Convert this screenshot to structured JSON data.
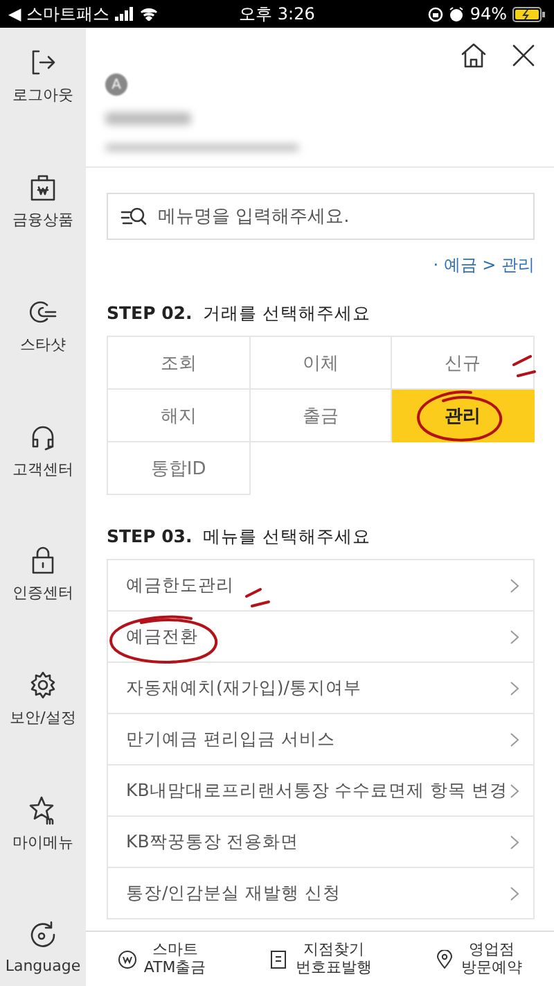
{
  "status_bar": {
    "back_app": "◀ 스마트패스",
    "time": "오후 3:26",
    "battery": "94%"
  },
  "sidebar": {
    "items": [
      {
        "label": "로그아웃"
      },
      {
        "label": "금융상품"
      },
      {
        "label": "스타샷"
      },
      {
        "label": "고객센터"
      },
      {
        "label": "인증센터"
      },
      {
        "label": "보안/설정"
      },
      {
        "label": "마이메뉴"
      },
      {
        "label": "Language"
      }
    ]
  },
  "header": {
    "avatar": "A"
  },
  "search": {
    "placeholder": "메뉴명을 입력해주세요."
  },
  "breadcrumb": "· 예금 > 관리",
  "step2": {
    "title": "STEP 02.",
    "subtitle": "거래를 선택해주세요",
    "options": [
      {
        "label": "조회",
        "selected": false
      },
      {
        "label": "이체",
        "selected": false
      },
      {
        "label": "신규",
        "selected": false
      },
      {
        "label": "해지",
        "selected": false
      },
      {
        "label": "출금",
        "selected": false
      },
      {
        "label": "관리",
        "selected": true
      },
      {
        "label": "통합ID",
        "selected": false
      }
    ]
  },
  "step3": {
    "title": "STEP 03.",
    "subtitle": "메뉴를 선택해주세요",
    "items": [
      {
        "label": "예금한도관리"
      },
      {
        "label": "예금전환"
      },
      {
        "label": "자동재예치(재가입)/통지여부"
      },
      {
        "label": "만기예금 편리입금 서비스"
      },
      {
        "label": "KB내맘대로프리랜서통장 수수료면제 항목 변경"
      },
      {
        "label": "KB짝꿍통장 전용화면"
      },
      {
        "label": "통장/인감분실 재발행 신청"
      }
    ]
  },
  "bottom_bar": [
    {
      "lines": [
        "스마트",
        "ATM출금"
      ]
    },
    {
      "lines": [
        "지점찾기",
        "번호표발행"
      ]
    },
    {
      "lines": [
        "영업점",
        "방문예약"
      ]
    }
  ]
}
